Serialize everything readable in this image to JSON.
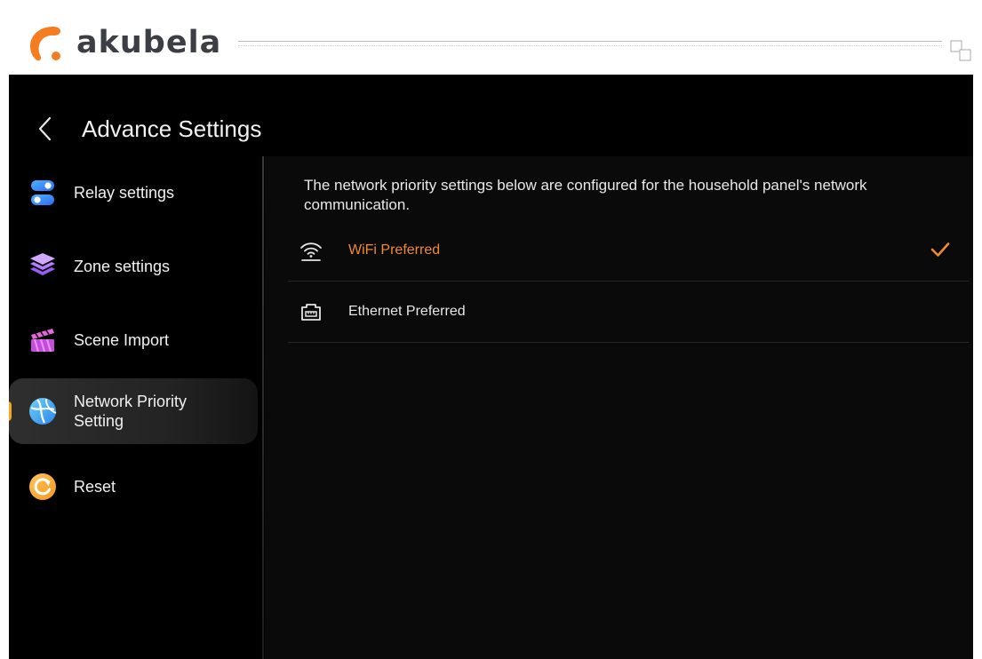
{
  "header": {
    "brand": "akubela",
    "brand_colors": {
      "orange": "#f57c1f",
      "text": "#3b3f45"
    }
  },
  "screen": {
    "title": "Advance Settings",
    "back_icon": "chevron-left-icon"
  },
  "sidebar": {
    "items": [
      {
        "label": "Relay settings",
        "icon": "toggle-switches-icon",
        "active": false
      },
      {
        "label": "Zone settings",
        "icon": "layers-icon",
        "active": false
      },
      {
        "label": "Scene Import",
        "icon": "clapperboard-icon",
        "active": false
      },
      {
        "label": "Network Priority Setting",
        "icon": "globe-icon",
        "active": true
      },
      {
        "label": "Reset",
        "icon": "reset-icon",
        "active": false
      }
    ]
  },
  "content": {
    "description": "The network priority settings below are configured for the household panel's network communication.",
    "options": [
      {
        "label": "WiFi Preferred",
        "icon": "wifi-icon",
        "selected": true
      },
      {
        "label": "Ethernet Preferred",
        "icon": "ethernet-icon",
        "selected": false
      }
    ]
  },
  "colors": {
    "accent": "#f08a2c",
    "active_marker": "#f5a623",
    "background": "#000000"
  }
}
